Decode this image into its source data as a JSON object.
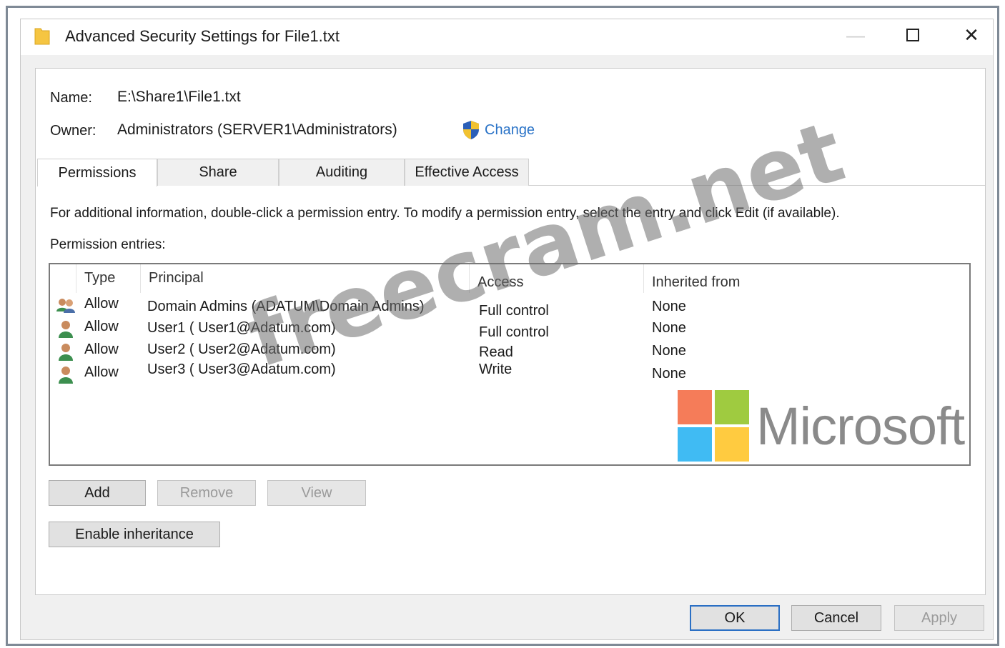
{
  "window": {
    "title": "Advanced Security Settings for File1.txt",
    "minimize_glyph": "—",
    "close_glyph": "✕"
  },
  "file": {
    "name_label": "Name:",
    "name_value": "E:\\Share1\\File1.txt",
    "owner_label": "Owner:",
    "owner_value": "Administrators (SERVER1\\Administrators)",
    "change_label": "Change"
  },
  "tabs": [
    {
      "label": "Permissions",
      "active": true
    },
    {
      "label": "Share",
      "active": false
    },
    {
      "label": "Auditing",
      "active": false
    },
    {
      "label": "Effective Access",
      "active": false
    }
  ],
  "permissions": {
    "info_text": "For additional information, double-click a permission entry. To modify a permission entry, select the entry and click Edit (if available).",
    "entries_label": "Permission entries:",
    "columns": {
      "type": "Type",
      "principal": "Principal",
      "access": "Access",
      "inherited": "Inherited from"
    },
    "entries": [
      {
        "icon": "group-icon",
        "type": "Allow",
        "principal": "Domain Admins (ADATUM\\Domain Admins)",
        "access": "Full control",
        "inherited": "None"
      },
      {
        "icon": "user-icon",
        "type": "Allow",
        "principal": "User1 ( User1@Adatum.com)",
        "access": "Full control",
        "inherited": "None"
      },
      {
        "icon": "user-icon",
        "type": "Allow",
        "principal": "User2 ( User2@Adatum.com)",
        "access": "Read",
        "inherited": "None"
      },
      {
        "icon": "user-icon",
        "type": "Allow",
        "principal": "User3 ( User3@Adatum.com)",
        "access": "Write",
        "inherited": "None"
      }
    ],
    "buttons": {
      "add": "Add",
      "remove": "Remove",
      "view": "View",
      "enable_inheritance": "Enable inheritance"
    }
  },
  "dialog_buttons": {
    "ok": "OK",
    "cancel": "Cancel",
    "apply": "Apply"
  },
  "overlays": {
    "watermark": "freecram.net",
    "brand_text": "Microsoft",
    "brand_colors": [
      "#f25022",
      "#7fba00",
      "#00a4ef",
      "#ffb900"
    ]
  },
  "colors": {
    "link": "#2a73c7",
    "default_button_border": "#2a6fc4"
  }
}
